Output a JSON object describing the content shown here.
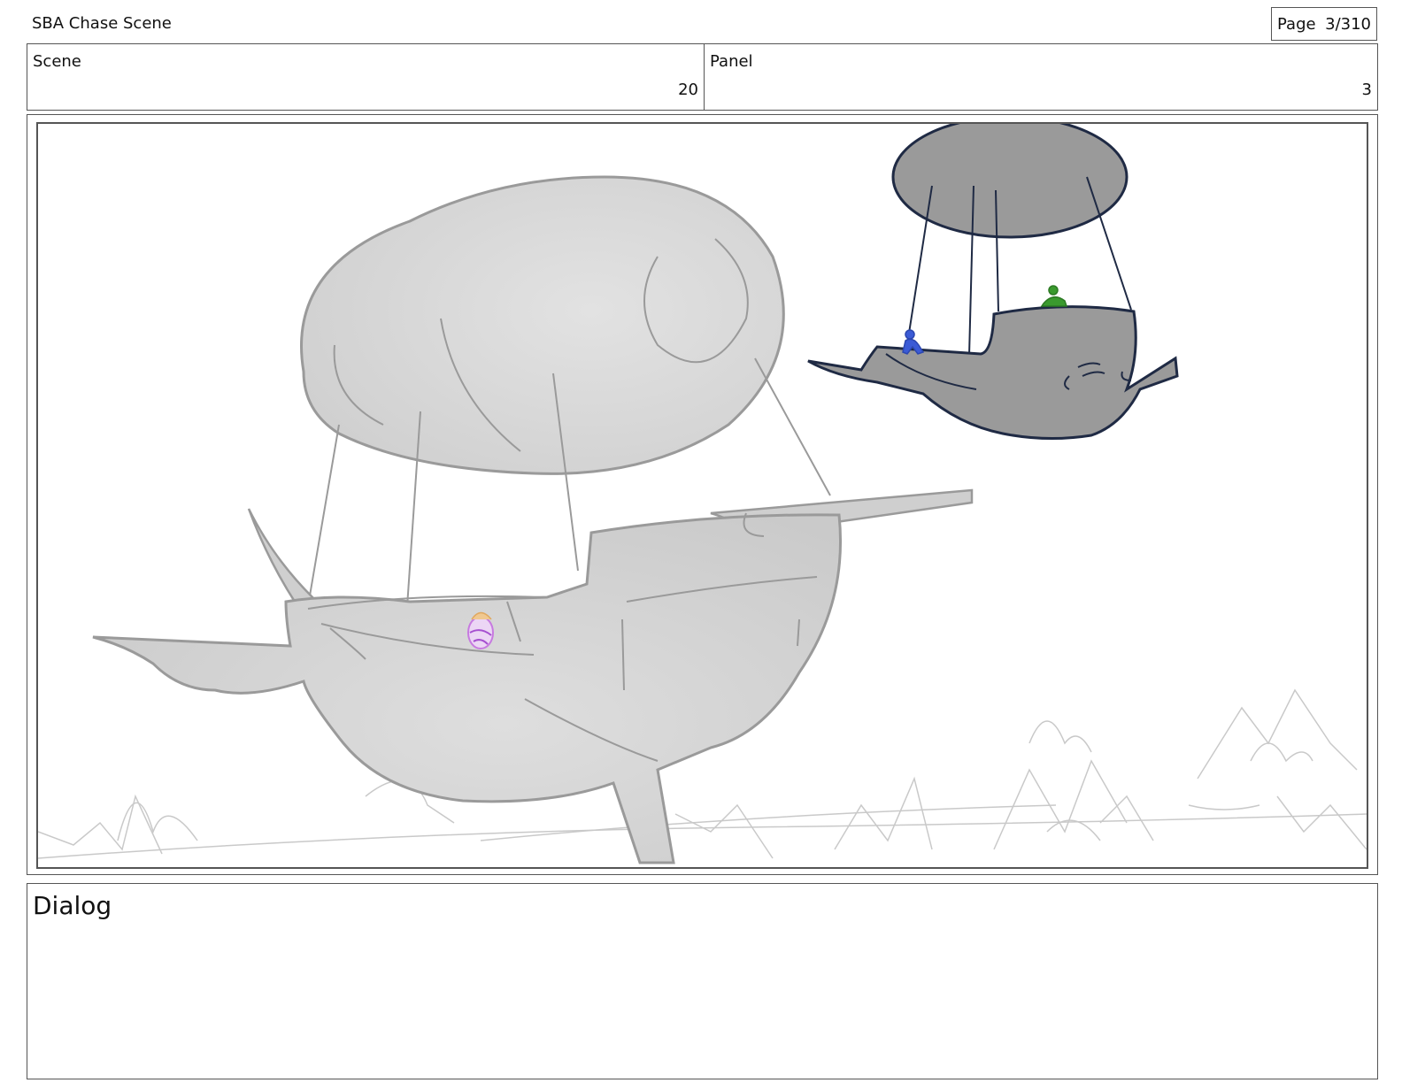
{
  "header": {
    "title": "SBA Chase Scene",
    "page_label": "Page",
    "page_value": "3/310"
  },
  "info": {
    "scene_label": "Scene",
    "scene_value": "20",
    "panel_label": "Panel",
    "panel_value": "3"
  },
  "dialog": {
    "label": "Dialog"
  },
  "colors": {
    "border": "#555555",
    "near_airship_fill": "#d4d4d4",
    "far_airship_fill": "#9a9a9a",
    "far_airship_outline": "#1f2a44",
    "character_blue": "#3b5bd6",
    "character_green": "#3a9a2e",
    "character_purple": "#c77ae0"
  }
}
